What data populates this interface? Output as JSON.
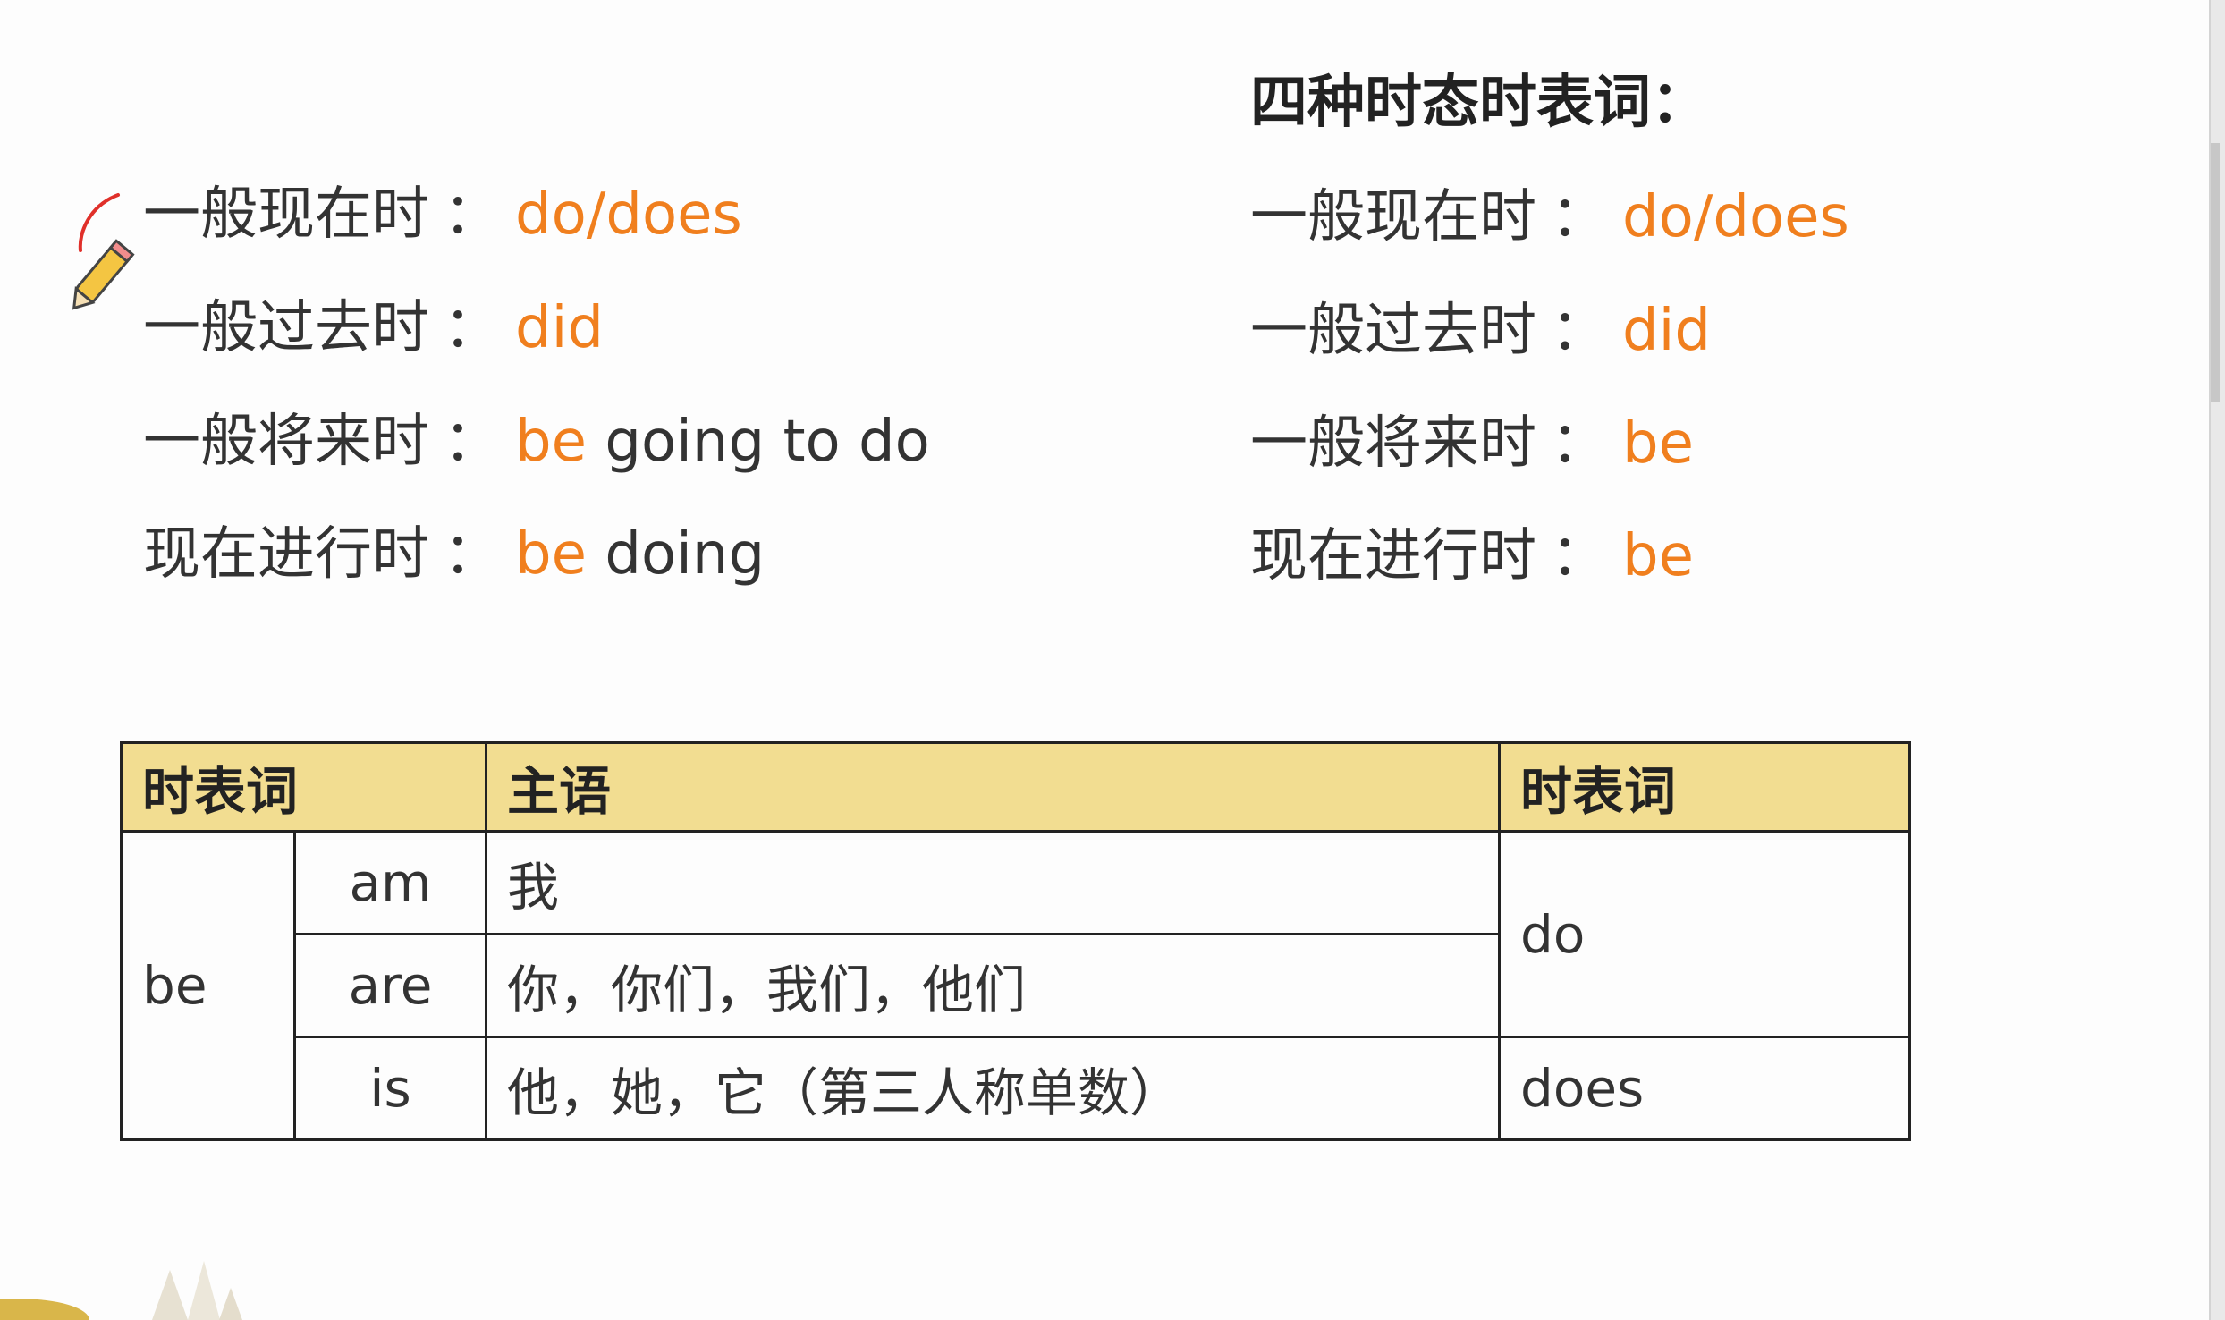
{
  "title": "四种时态时表词：",
  "left_rules": [
    {
      "tense": "一般现在时",
      "colon": "：",
      "hl": "do/does",
      "rest": ""
    },
    {
      "tense": "一般过去时",
      "colon": "：",
      "hl": "did",
      "rest": ""
    },
    {
      "tense": "一般将来时",
      "colon": "：",
      "hl": "be",
      "rest": " going to do"
    },
    {
      "tense": "现在进行时",
      "colon": "：",
      "hl": "be",
      "rest": " doing"
    }
  ],
  "right_rules": [
    {
      "tense": "一般现在时",
      "colon": "：",
      "hl": "do/does"
    },
    {
      "tense": "一般过去时",
      "colon": "：",
      "hl": "did"
    },
    {
      "tense": "一般将来时",
      "colon": "：",
      "hl": "be"
    },
    {
      "tense": "现在进行时",
      "colon": "：",
      "hl": "be"
    }
  ],
  "table": {
    "headers": [
      "时表词",
      "主语",
      "时表词"
    ],
    "be_label": "be",
    "rows": [
      {
        "form": "am",
        "subject": "我"
      },
      {
        "form": "are",
        "subject": "你，你们，我们，他们"
      },
      {
        "form": "is",
        "subject": "他，她，它（第三人称单数）"
      }
    ],
    "do_label": "do",
    "does_label": "does"
  },
  "colors": {
    "highlight": "#f07f1e",
    "table_header_bg": "#f2dd91",
    "text": "#333333"
  },
  "icons": {
    "pencil": "pencil-icon"
  }
}
